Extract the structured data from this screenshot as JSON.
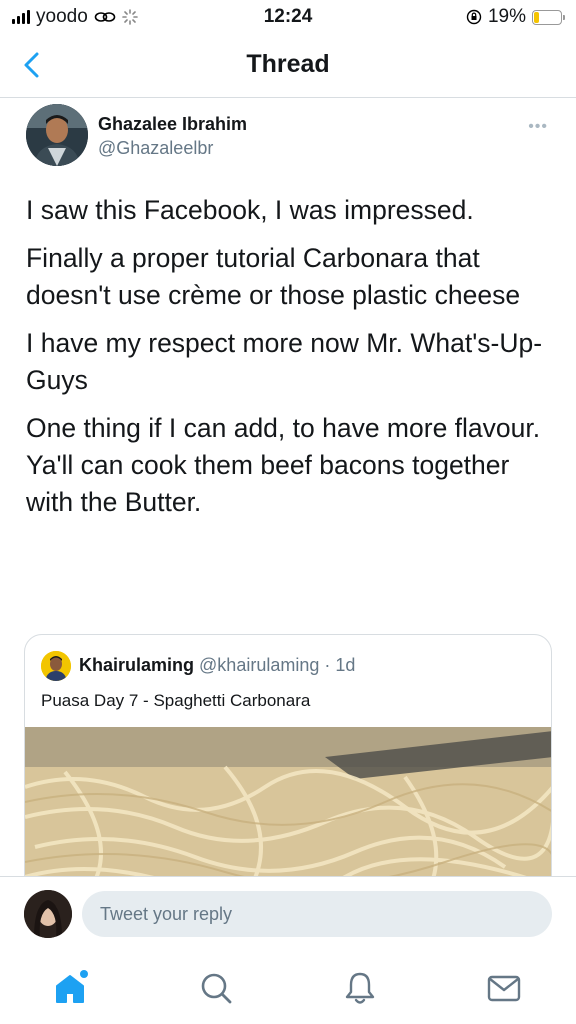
{
  "status_bar": {
    "carrier": "yoodo",
    "time": "12:24",
    "battery": "19%",
    "battery_level": 0.19
  },
  "header": {
    "title": "Thread",
    "back_icon": "chevron-left-icon"
  },
  "tweet": {
    "author_name": "Ghazalee Ibrahim",
    "author_handle": "@Ghazaleelbr",
    "more_icon": "more-dots-icon",
    "paragraphs": [
      "I saw this Facebook, I was impressed.",
      "Finally a proper tutorial Carbonara that doesn't use crème or those plastic cheese",
      "I have my respect more now Mr. What's-Up-Guys",
      "One thing if I can add, to have more flavour. Ya'll can cook them beef bacons together with the Butter."
    ]
  },
  "quoted_tweet": {
    "author_name": "Khairulaming",
    "author_handle": "@khairulaming",
    "age": "· 1d",
    "text": "Puasa Day 7 - Spaghetti Carbonara"
  },
  "reply": {
    "placeholder": "Tweet your reply"
  },
  "tabs": [
    {
      "icon": "home-icon",
      "active": true
    },
    {
      "icon": "search-icon",
      "active": false
    },
    {
      "icon": "notifications-icon",
      "active": false
    },
    {
      "icon": "messages-icon",
      "active": false
    }
  ],
  "colors": {
    "accent": "#1da1f2",
    "text": "#14171a",
    "secondary": "#657786",
    "border": "#d8dde1"
  }
}
